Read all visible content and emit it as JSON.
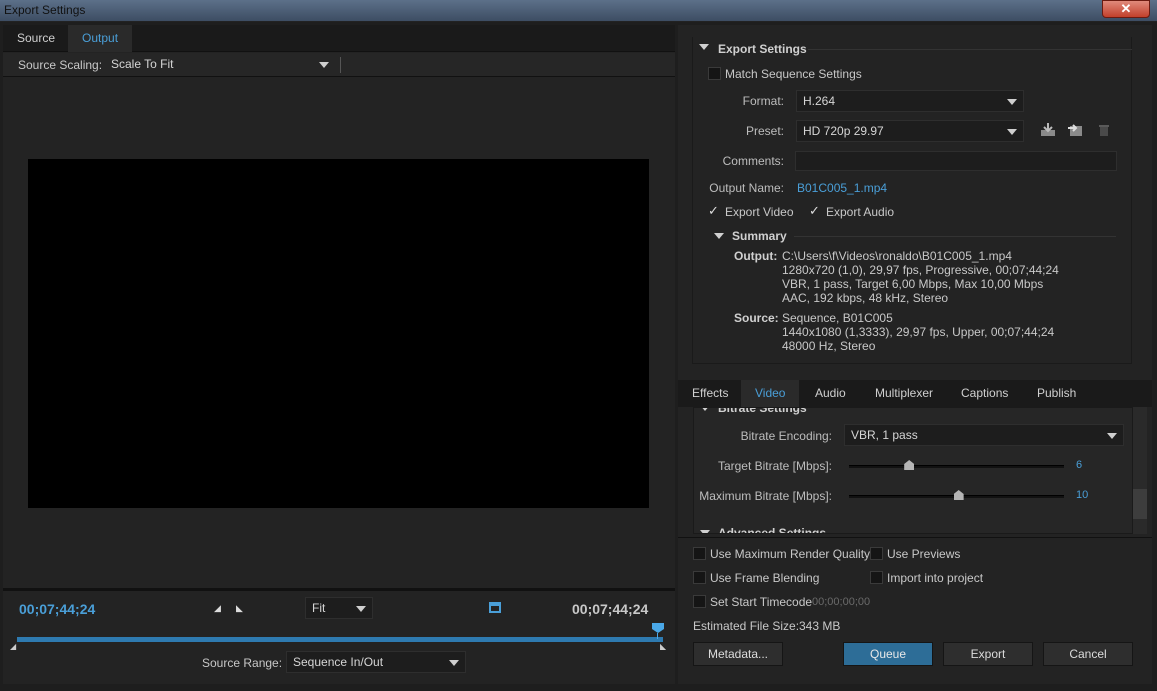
{
  "window": {
    "title": "Export Settings",
    "close_label": "✕"
  },
  "left": {
    "tabs": [
      {
        "label": "Source"
      },
      {
        "label": "Output"
      }
    ],
    "source_scaling": {
      "label": "Source Scaling:",
      "value": "Scale To Fit"
    },
    "timecode_in": "00;07;44;24",
    "timecode_out": "00;07;44;24",
    "zoom": {
      "value": "Fit"
    },
    "source_range": {
      "label": "Source Range:",
      "value": "Sequence In/Out"
    }
  },
  "export_settings": {
    "header": "Export Settings",
    "match_sequence": "Match Sequence Settings",
    "format": {
      "label": "Format:",
      "value": "H.264"
    },
    "preset": {
      "label": "Preset:",
      "value": "HD 720p 29.97"
    },
    "comments": {
      "label": "Comments:",
      "value": ""
    },
    "output_name": {
      "label": "Output Name:",
      "value": "B01C005_1.mp4"
    },
    "export_video": "Export Video",
    "export_audio": "Export Audio",
    "summary": {
      "header": "Summary",
      "output_label": "Output:",
      "output_lines": [
        "C:\\Users\\f\\Videos\\ronaldo\\B01C005_1.mp4",
        "1280x720 (1,0), 29,97 fps, Progressive, 00;07;44;24",
        "VBR, 1 pass, Target 6,00 Mbps, Max 10,00 Mbps",
        "AAC, 192 kbps, 48 kHz, Stereo"
      ],
      "source_label": "Source:",
      "source_lines": [
        "Sequence, B01C005",
        "1440x1080 (1,3333), 29,97 fps, Upper, 00;07;44;24",
        "48000 Hz, Stereo"
      ]
    }
  },
  "settings_tabs": [
    {
      "label": "Effects"
    },
    {
      "label": "Video"
    },
    {
      "label": "Audio"
    },
    {
      "label": "Multiplexer"
    },
    {
      "label": "Captions"
    },
    {
      "label": "Publish"
    }
  ],
  "bitrate": {
    "section_header": "Bitrate Settings",
    "encoding": {
      "label": "Bitrate Encoding:",
      "value": "VBR, 1 pass"
    },
    "target": {
      "label": "Target Bitrate [Mbps]:",
      "value": "6",
      "fraction": 0.28
    },
    "maximum": {
      "label": "Maximum Bitrate [Mbps]:",
      "value": "10",
      "fraction": 0.51
    },
    "advanced_header": "Advanced Settings"
  },
  "options": {
    "max_render": "Use Maximum Render Quality",
    "use_previews": "Use Previews",
    "frame_blending": "Use Frame Blending",
    "import_project": "Import into project",
    "start_timecode": "Set Start Timecode",
    "start_timecode_value": "00;00;00;00",
    "file_size_label": "Estimated File Size:",
    "file_size_value": "343 MB"
  },
  "buttons": {
    "metadata": "Metadata...",
    "queue": "Queue",
    "export": "Export",
    "cancel": "Cancel"
  },
  "colors": {
    "accent": "#4a9fd8",
    "queue_button": "#2d6d97",
    "panel": "#232323"
  }
}
